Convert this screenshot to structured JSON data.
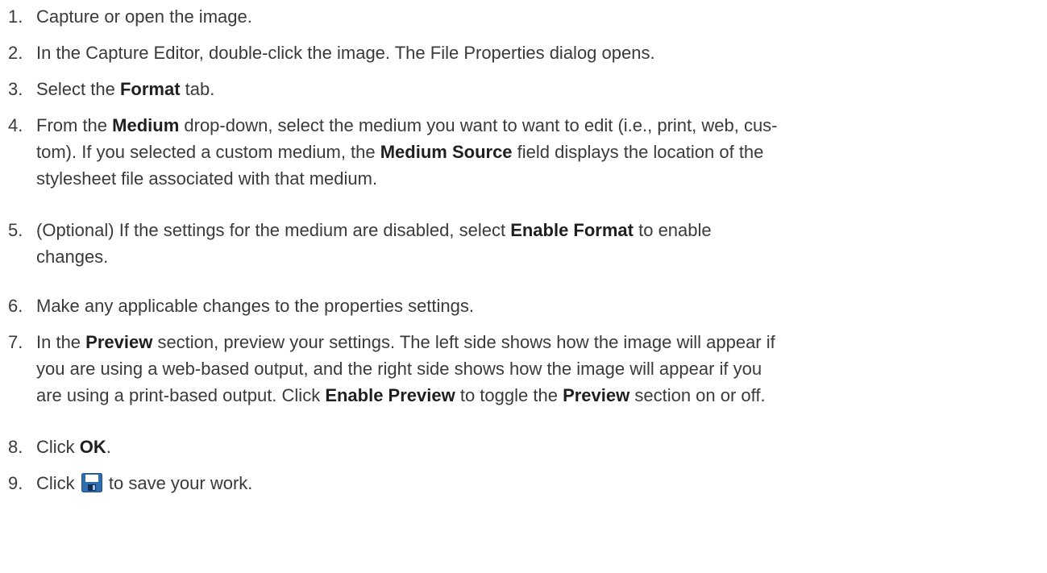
{
  "steps": [
    {
      "num": "1.",
      "parts": [
        {
          "t": "Capture or open the image."
        }
      ]
    },
    {
      "num": "2.",
      "parts": [
        {
          "t": "In the Capture Editor, double-click the image. The File Properties dialog opens."
        }
      ]
    },
    {
      "num": "3.",
      "parts": [
        {
          "t": "Select the "
        },
        {
          "t": "Format",
          "b": true
        },
        {
          "t": " tab."
        }
      ]
    },
    {
      "num": "4.",
      "parts": [
        {
          "t": "From the "
        },
        {
          "t": "Medium",
          "b": true
        },
        {
          "t": " drop-down, select the medium you want to want to edit (i.e., print, web, cus-"
        },
        {
          "br": true
        },
        {
          "t": "tom). If you selected a custom medium, the "
        },
        {
          "t": "Medium Source",
          "b": true
        },
        {
          "t": " field displays the location of the"
        },
        {
          "br": true
        },
        {
          "t": "stylesheet file associated with that medium."
        }
      ]
    },
    {
      "num": "5.",
      "parts": [
        {
          "t": "(Optional) If the settings for the medium are disabled, select "
        },
        {
          "t": "Enable Format",
          "b": true
        },
        {
          "t": " to enable"
        },
        {
          "br": true
        },
        {
          "t": "changes."
        }
      ]
    },
    {
      "num": "6.",
      "parts": [
        {
          "t": "Make any applicable changes to the properties settings."
        }
      ]
    },
    {
      "num": "7.",
      "parts": [
        {
          "t": "In the "
        },
        {
          "t": "Preview",
          "b": true
        },
        {
          "t": " section, preview your settings. The left side shows how the image will appear if"
        },
        {
          "br": true
        },
        {
          "t": "you are using a web-based output, and the right side shows how the image will appear if you"
        },
        {
          "br": true
        },
        {
          "t": "are using a print-based output. Click "
        },
        {
          "t": "Enable Preview",
          "b": true
        },
        {
          "t": " to toggle the "
        },
        {
          "t": "Preview",
          "b": true
        },
        {
          "t": " section on or off."
        }
      ]
    },
    {
      "num": "8.",
      "parts": [
        {
          "t": "Click "
        },
        {
          "t": "OK",
          "b": true
        },
        {
          "t": "."
        }
      ]
    },
    {
      "num": "9.",
      "parts": [
        {
          "t": "Click "
        },
        {
          "icon": "save-icon"
        },
        {
          "t": " to save your work."
        }
      ]
    }
  ]
}
